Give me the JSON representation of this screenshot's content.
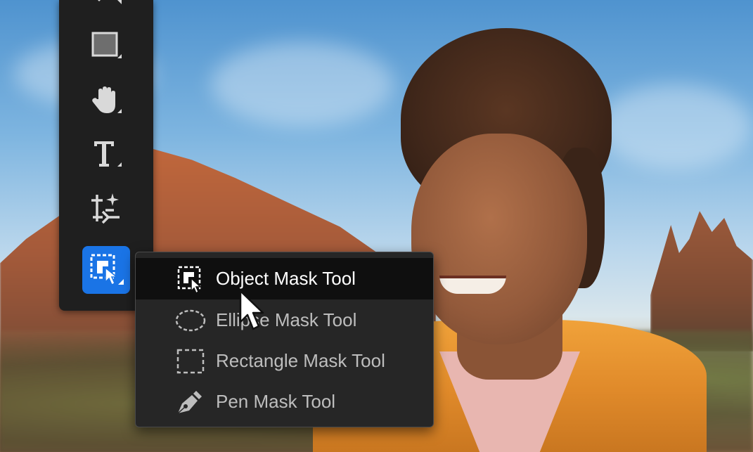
{
  "toolbar": {
    "tools": [
      {
        "name": "brush-icon"
      },
      {
        "name": "rectangle-shape-icon"
      },
      {
        "name": "hand-icon"
      },
      {
        "name": "text-icon"
      },
      {
        "name": "transform-sparkle-icon"
      },
      {
        "name": "object-mask-icon",
        "active": true
      }
    ]
  },
  "flyout": {
    "items": [
      {
        "label": "Object Mask Tool",
        "icon": "object-mask-icon",
        "selected": true
      },
      {
        "label": "Ellipse Mask Tool",
        "icon": "ellipse-mask-icon"
      },
      {
        "label": "Rectangle Mask Tool",
        "icon": "rectangle-mask-icon"
      },
      {
        "label": "Pen Mask Tool",
        "icon": "pen-mask-icon"
      }
    ]
  },
  "colors": {
    "toolbar_bg": "#1f1f1f",
    "active_tool": "#1a74e6",
    "menu_bg": "#262626",
    "menu_selected_bg": "#0f0f0f"
  }
}
